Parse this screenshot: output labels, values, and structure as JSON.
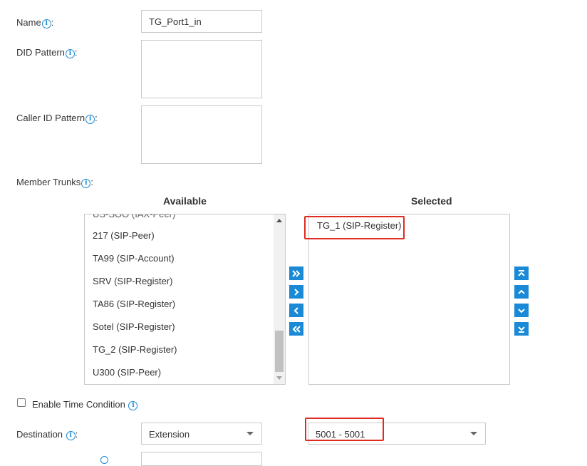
{
  "form": {
    "name": {
      "label": "Name",
      "value": "TG_Port1_in"
    },
    "did_pattern": {
      "label": "DID Pattern",
      "value": ""
    },
    "caller_id_pattern": {
      "label": "Caller ID Pattern",
      "value": ""
    },
    "member_trunks": {
      "label": "Member Trunks"
    },
    "enable_time_condition": {
      "label": "Enable Time Condition",
      "checked": false
    },
    "destination": {
      "label": "Destination",
      "type_value": "Extension",
      "target_value": "5001 - 5001"
    }
  },
  "trunks": {
    "available_header": "Available",
    "selected_header": "Selected",
    "available": [
      "US-SOO (IAX-Peer)",
      "217 (SIP-Peer)",
      "TA99 (SIP-Account)",
      "SRV (SIP-Register)",
      "TA86 (SIP-Register)",
      "Sotel (SIP-Register)",
      "TG_2 (SIP-Register)",
      "U300 (SIP-Peer)"
    ],
    "selected": [
      "TG_1 (SIP-Register)"
    ]
  },
  "icons": {
    "info": "info-icon",
    "move_all_right": "double-chevron-right-icon",
    "move_right": "chevron-right-icon",
    "move_left": "chevron-left-icon",
    "move_all_left": "double-chevron-left-icon",
    "move_top": "move-top-icon",
    "move_up": "chevron-up-icon",
    "move_down": "chevron-down-icon",
    "move_bottom": "move-bottom-icon"
  },
  "colors": {
    "accent": "#1a8ad6",
    "highlight": "#e02b20"
  }
}
